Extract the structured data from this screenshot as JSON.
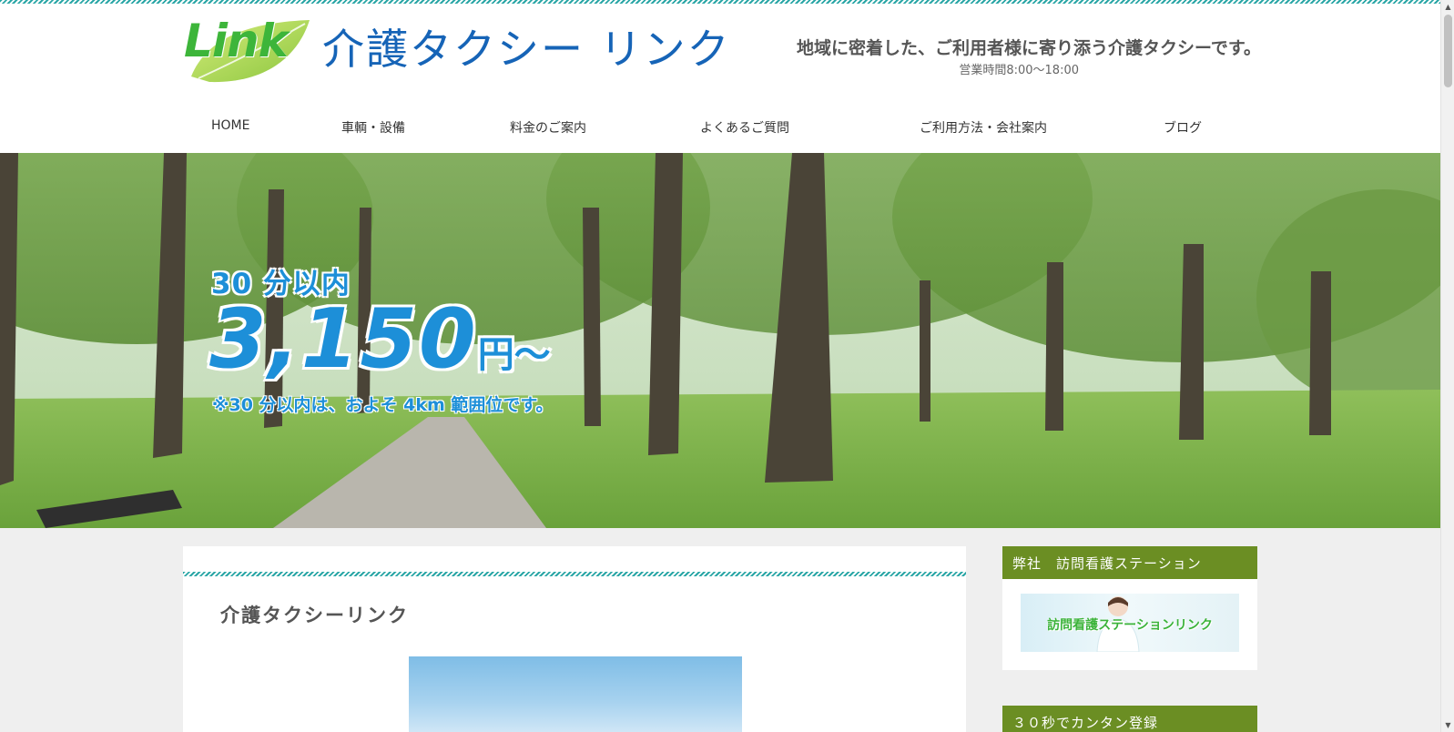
{
  "header": {
    "logo_text": "Link",
    "site_name": "介護タクシー リンク",
    "tagline": "地域に密着した、ご利用者様に寄り添う介護タクシーです。",
    "hours": "営業時間8:00〜18:00"
  },
  "nav": {
    "items": [
      {
        "label": "HOME"
      },
      {
        "label": "車輌・設備"
      },
      {
        "label": "料金のご案内"
      },
      {
        "label": "よくあるご質問"
      },
      {
        "label": "ご利用方法・会社案内"
      },
      {
        "label": "ブログ"
      }
    ]
  },
  "hero": {
    "sub": "30 分以内",
    "price": "3,150",
    "unit": "円〜",
    "note": "※30 分以内は、およそ 4km 範囲位です。"
  },
  "main": {
    "title": "介護タクシーリンク"
  },
  "sidebar": {
    "widgets": [
      {
        "title": "弊社　訪問看護ステーション",
        "banner_text": "訪問看護ステーションリンク"
      },
      {
        "title": "３０秒でカンタン登録"
      }
    ]
  },
  "colors": {
    "accent_teal": "#2aa6a6",
    "brand_blue": "#1664b7",
    "logo_green": "#3db53a",
    "widget_green": "#6b8e23",
    "price_blue": "#1d8fd8"
  },
  "icons": {
    "scroll_up": "triangle-up-icon",
    "scroll_down": "triangle-down-icon"
  }
}
